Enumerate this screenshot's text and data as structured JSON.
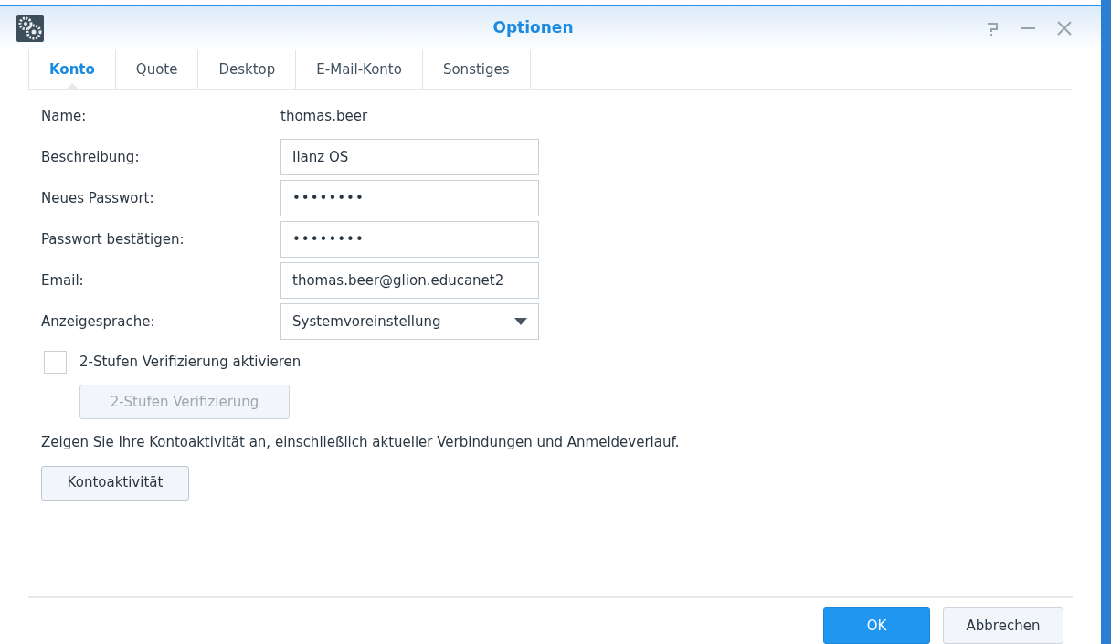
{
  "window": {
    "title": "Optionen"
  },
  "tabs": [
    {
      "label": "Konto",
      "selected": true
    },
    {
      "label": "Quote",
      "selected": false
    },
    {
      "label": "Desktop",
      "selected": false
    },
    {
      "label": "E-Mail-Konto",
      "selected": false
    },
    {
      "label": "Sonstiges",
      "selected": false
    }
  ],
  "form": [
    {
      "kind": "static",
      "label": "Name:",
      "value": "thomas.beer"
    },
    {
      "kind": "text",
      "label": "Beschreibung:",
      "value": "Ilanz OS"
    },
    {
      "kind": "password",
      "label": "Neues Passwort:",
      "value": "••••••••"
    },
    {
      "kind": "password",
      "label": "Passwort bestätigen:",
      "value": "••••••••"
    },
    {
      "kind": "text",
      "label": "Email:",
      "value": "thomas.beer@glion.educanet2"
    },
    {
      "kind": "select",
      "label": "Anzeigesprache:",
      "value": "Systemvoreinstellung"
    }
  ],
  "two_step": {
    "label": "2-Stufen Verifizierung aktivieren",
    "checked": false,
    "button": {
      "label": "2-Stufen Verifizierung",
      "disabled": true
    }
  },
  "activity": {
    "text": "Zeigen Sie Ihre Kontoaktivität an, einschließlich aktueller Verbindungen und Anmeldeverlauf.",
    "button": "Kontoaktivität"
  },
  "footer": [
    {
      "label": "OK",
      "kind": "primary"
    },
    {
      "label": "Abbrechen",
      "kind": "secondary"
    }
  ]
}
